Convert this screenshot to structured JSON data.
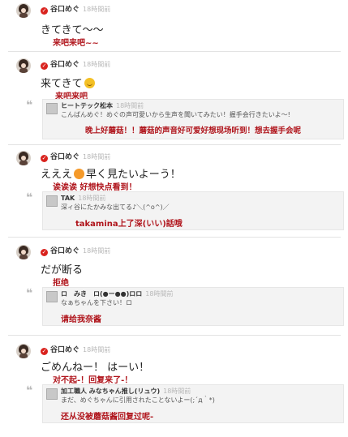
{
  "posts": [
    {
      "author": "谷口めぐ",
      "time": "18時間前",
      "text": "きてきて〜〜",
      "translation": "来吧来吧~~",
      "emoji": null,
      "text2": ""
    },
    {
      "author": "谷口めぐ",
      "time": "18時間前",
      "text": "来てきて",
      "translation": "来吧来吧",
      "emoji": "smile-face",
      "text2": "",
      "reply": {
        "author": "ヒートテック松本",
        "time": "18時間前",
        "text": "こんばんめぐ！めぐの声可愛いから生声を聞いてみたい！握手会行きたいよ〜!",
        "translation": "晚上好蘑菇！！蘑菇的声音好可爱好想现场听到！想去握手会呢"
      }
    },
    {
      "author": "谷口めぐ",
      "time": "18時間前",
      "text": "えええ",
      "translation": "诶诶诶 好想快点看到！",
      "emoji": "orange-face",
      "text2": "早く見たいよーう！",
      "reply": {
        "author": "TAK",
        "time": "18時間前",
        "text": "深ィ谷にたかみな出てる♪＼(^o^)／",
        "translation": "takamina上了深(いい)話哦"
      }
    },
    {
      "author": "谷口めぐ",
      "time": "18時間前",
      "text": "だが断る",
      "translation": "拒绝",
      "emoji": null,
      "text2": "",
      "reply": {
        "author": "ロ　みき　ロ(●ー●●)ロロ",
        "time": "18時間前",
        "text": "なぁちゃんを下さい！ロ",
        "translation": "请给我奈酱"
      }
    },
    {
      "author": "谷口めぐ",
      "time": "18時間前",
      "text": "ごめんねー！ はーい！",
      "translation": "对不起-！回复来了-！",
      "emoji": null,
      "text2": "",
      "reply": {
        "author": "加工職人 みなちゃん推し(リュウ)",
        "time": "18時間前",
        "text": "まだ、めぐちゃんに引用されたことないよー(;´д｀*)",
        "translation": "还从没被蘑菇酱回复过呢-"
      }
    }
  ],
  "colors": {
    "verified": "#d9231e",
    "translation": "#b0151c"
  },
  "icons": {
    "verified": "✓",
    "quote": "❝"
  }
}
